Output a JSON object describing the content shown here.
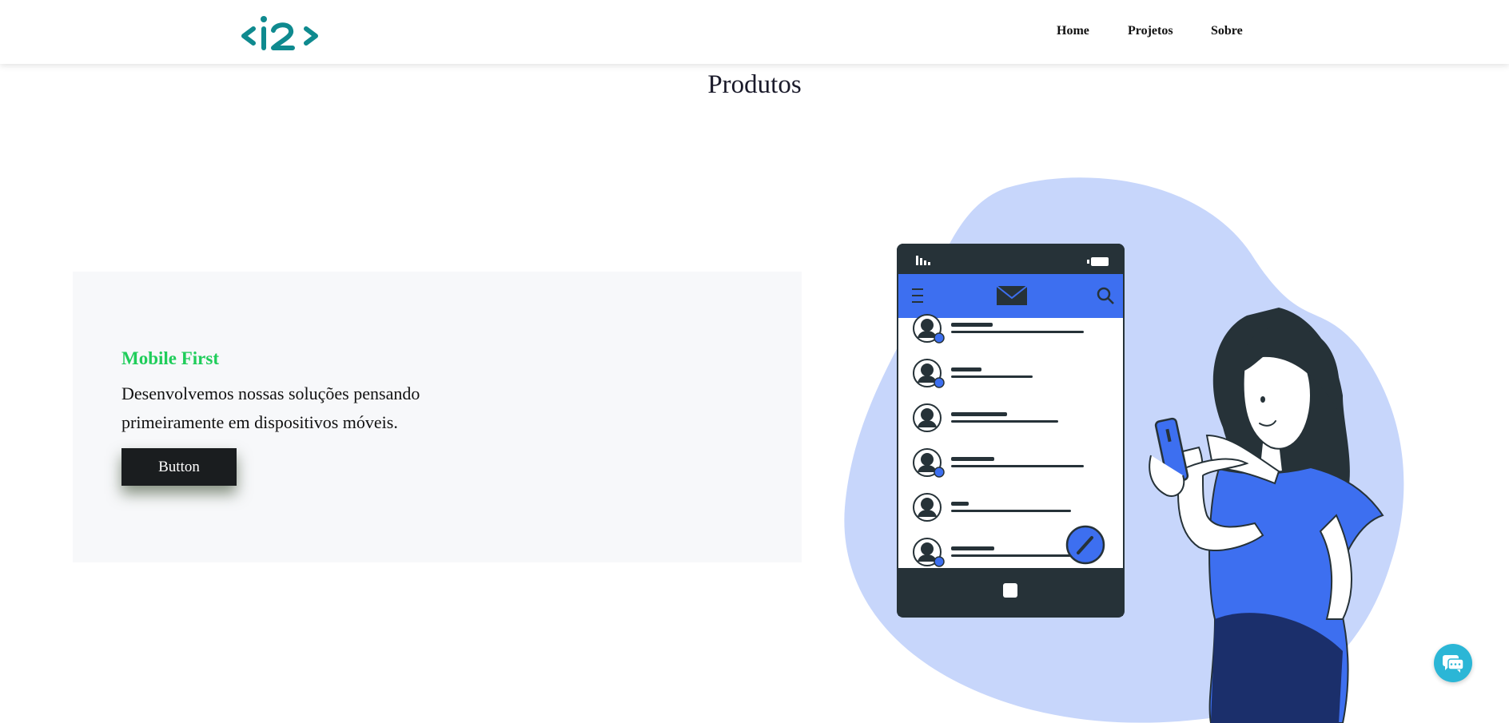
{
  "header": {
    "logo_text": "<i2>",
    "nav": [
      {
        "label": "Home"
      },
      {
        "label": "Projetos"
      },
      {
        "label": "Sobre"
      }
    ]
  },
  "section": {
    "title": "Produtos"
  },
  "card": {
    "title": "Mobile First",
    "text": "Desenvolvemos nossas soluções pensando primeiramente em dispositivos móveis.",
    "button_label": "Button"
  },
  "colors": {
    "brand": "#0f8a8f",
    "card_title": "#1fcd5a",
    "button_bg": "#1a1d1f",
    "illustration_blob": "#c7d6fb",
    "illustration_accent": "#3d6ff0",
    "illustration_dark": "#263238",
    "chat_widget": "#2bb6d6"
  },
  "icons": {
    "logo": "i2-logo",
    "chat": "chat-bubbles-icon",
    "illustration": "woman-using-phone-illustration"
  }
}
